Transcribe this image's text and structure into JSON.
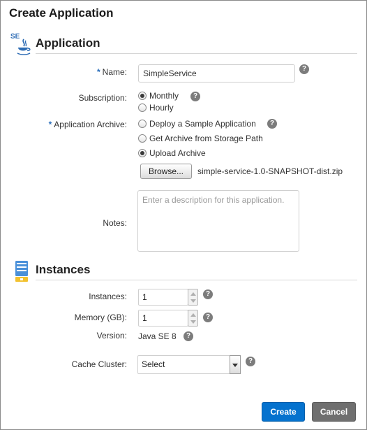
{
  "dialog": {
    "title": "Create Application"
  },
  "application_section": {
    "icon_badge": "SE",
    "title": "Application",
    "name": {
      "required_mark": "*",
      "label": "Name:",
      "value": "SimpleService"
    },
    "subscription": {
      "label": "Subscription:",
      "options": [
        "Monthly",
        "Hourly"
      ],
      "selected": "Monthly"
    },
    "archive": {
      "required_mark": "*",
      "label": "Application Archive:",
      "options": [
        "Deploy a Sample Application",
        "Get Archive from Storage Path",
        "Upload Archive"
      ],
      "selected": "Upload Archive",
      "browse_label": "Browse...",
      "file_name": "simple-service-1.0-SNAPSHOT-dist.zip"
    },
    "notes": {
      "label": "Notes:",
      "placeholder": "Enter a description for this application."
    }
  },
  "instances_section": {
    "title": "Instances",
    "instances": {
      "label": "Instances:",
      "value": "1"
    },
    "memory": {
      "label": "Memory (GB):",
      "value": "1"
    },
    "version": {
      "label": "Version:",
      "value": "Java SE 8"
    },
    "cache_cluster": {
      "label": "Cache Cluster:",
      "selected": "Select"
    }
  },
  "help_glyph": "?",
  "footer": {
    "create_label": "Create",
    "cancel_label": "Cancel"
  },
  "icons": {
    "java_se": "java-se-icon",
    "instances": "server-icon",
    "help": "help-icon",
    "spinner_up": "chevron-up-icon",
    "spinner_down": "chevron-down-icon",
    "select_arrow": "caret-down-icon"
  },
  "colors": {
    "primary_button": "#0572ce",
    "secondary_button": "#6f6f6f",
    "required_mark": "#2a6ebb",
    "java_icon": "#2f6db5",
    "server_icon": "#4a90d9"
  }
}
